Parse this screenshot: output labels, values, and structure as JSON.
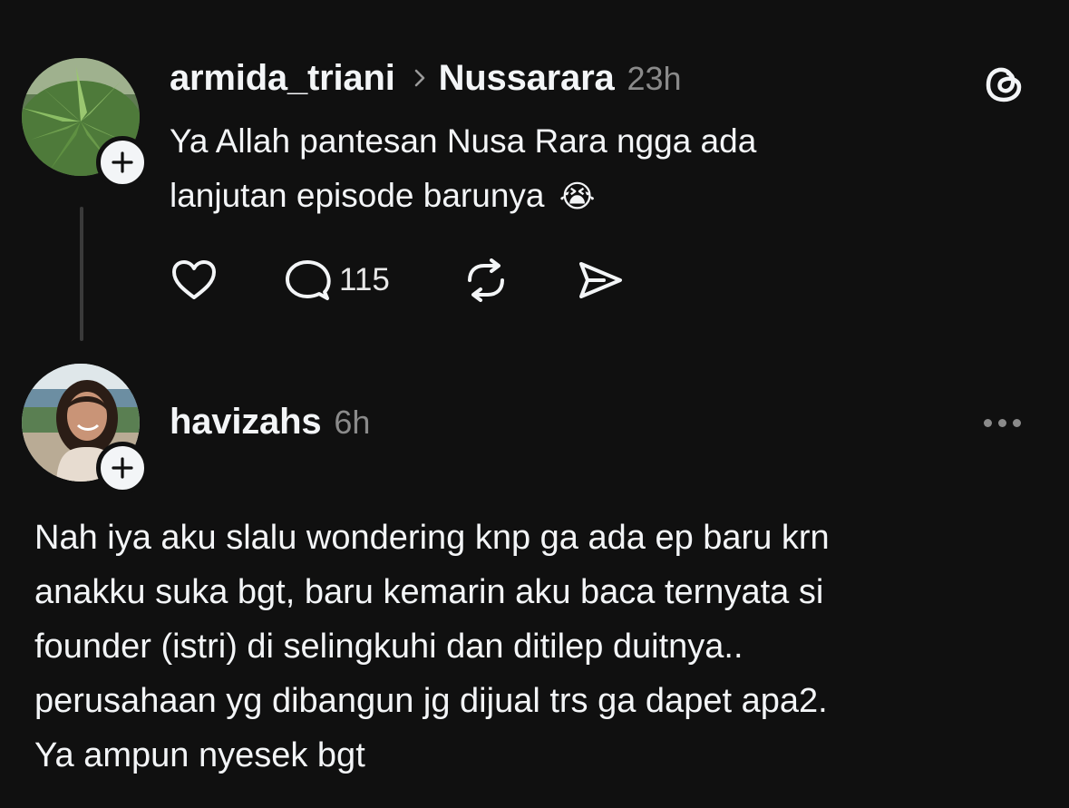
{
  "post": {
    "username": "armida_triani",
    "community": "Nussarara",
    "time": "23h",
    "text_line1": "Ya Allah pantesan Nusa Rara ngga ada",
    "text_line2": "lanjutan episode barunya",
    "emoji": "😭",
    "reply_count": "115"
  },
  "reply": {
    "username": "havizahs",
    "time": "6h",
    "lines": [
      "Nah iya aku slalu wondering knp ga ada ep baru krn",
      "anakku suka bgt, baru kemarin aku baca ternyata si",
      "founder (istri) di selingkuhi dan ditilep duitnya..",
      "perusahaan yg dibangun jg dijual trs ga dapet apa2.",
      "Ya ampun nyesek bgt"
    ]
  },
  "icons": {
    "threads_logo": "threads-logo-icon",
    "like": "heart-icon",
    "comment": "comment-icon",
    "repost": "repost-icon",
    "share": "send-icon",
    "follow": "plus-icon",
    "more": "more-icon"
  },
  "colors": {
    "background": "#101010",
    "text": "#f3f5f7",
    "secondary": "#8a8a8a"
  }
}
